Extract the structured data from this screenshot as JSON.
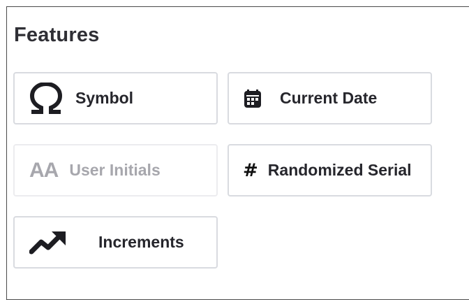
{
  "section": {
    "title": "Features"
  },
  "features": [
    {
      "label": "Symbol",
      "icon": "omega-icon",
      "enabled": true
    },
    {
      "label": "Current Date",
      "icon": "calendar-icon",
      "enabled": true
    },
    {
      "label": "User Initials",
      "icon": "initials-icon",
      "icon_text": "AA",
      "enabled": false
    },
    {
      "label": "Randomized Serial",
      "icon": "hash-icon",
      "icon_text": "#",
      "enabled": true
    },
    {
      "label": "Increments",
      "icon": "trending-up-icon",
      "enabled": true
    }
  ],
  "colors": {
    "text": "#26262c",
    "disabled_text": "#a7a7ad",
    "border": "#d9dbe0"
  }
}
